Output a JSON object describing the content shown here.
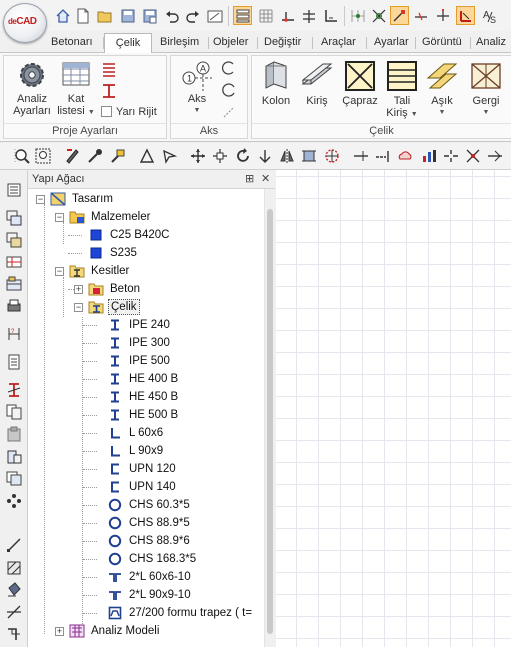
{
  "app": {
    "logo_text_a": "de",
    "logo_text_b": "CAD"
  },
  "ribbon_tabs": [
    "Betonarı",
    "Çelik",
    "Birleşim",
    "Objeler",
    "Değiştir",
    "Araçlar",
    "Ayarlar",
    "Görüntü",
    "Analiz"
  ],
  "active_tab": "Çelik",
  "ribbon": {
    "groups": {
      "proje": "Proje Ayarları",
      "aks": "Aks",
      "celik": "Çelik"
    },
    "buttons": {
      "analiz_line1": "Analiz",
      "analiz_line2": "Ayarları",
      "kat_line1": "Kat",
      "kat_line2": "listesi",
      "yari_rijit": "Yarı Rijit",
      "aks": "Aks",
      "kolon": "Kolon",
      "kiris": "Kiriş",
      "capraz": "Çapraz",
      "tali_line1": "Tali",
      "tali_line2": "Kiriş",
      "asik": "Aşık",
      "gergi": "Gergi"
    }
  },
  "panel": {
    "title": "Yapı Ağacı",
    "pin": "⊞",
    "close": "✕"
  },
  "tree": {
    "tasarim": "Tasarım",
    "malzemeler": "Malzemeler",
    "materials": [
      "C25 B420C",
      "S235"
    ],
    "kesitler": "Kesitler",
    "beton": "Beton",
    "celik": "Çelik",
    "sections": [
      {
        "label": "IPE 240",
        "icon": "i-section-icon"
      },
      {
        "label": "IPE 300",
        "icon": "i-section-icon"
      },
      {
        "label": "IPE 500",
        "icon": "i-section-icon"
      },
      {
        "label": "HE 400 B",
        "icon": "i-section-icon"
      },
      {
        "label": "HE 450 B",
        "icon": "i-section-icon"
      },
      {
        "label": "HE 500 B",
        "icon": "i-section-icon"
      },
      {
        "label": "L 60x6",
        "icon": "angle-section-icon"
      },
      {
        "label": "L 90x9",
        "icon": "angle-section-icon"
      },
      {
        "label": "UPN 120",
        "icon": "channel-section-icon"
      },
      {
        "label": "UPN 140",
        "icon": "channel-section-icon"
      },
      {
        "label": "CHS 60.3*5",
        "icon": "pipe-section-icon"
      },
      {
        "label": "CHS 88.9*5",
        "icon": "pipe-section-icon"
      },
      {
        "label": "CHS 88.9*6",
        "icon": "pipe-section-icon"
      },
      {
        "label": "CHS 168.3*5",
        "icon": "pipe-section-icon"
      },
      {
        "label": "2*L 60x6-10",
        "icon": "double-angle-section-icon"
      },
      {
        "label": "2*L 90x9-10",
        "icon": "double-angle-section-icon"
      },
      {
        "label": "27/200 formu trapez ( t=",
        "icon": "trapezoid-section-icon"
      }
    ],
    "analiz_modeli": "Analiz Modeli"
  },
  "colors": {
    "accent": "#f6d08a",
    "brand_red": "#c41e1e",
    "section_blue": "#1f3f8f"
  }
}
